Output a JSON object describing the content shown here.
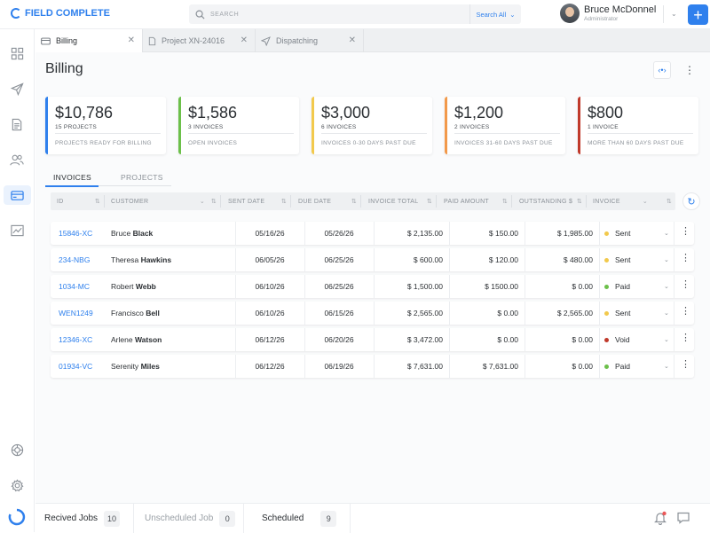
{
  "app": {
    "brand": "FIELD COMPLETE",
    "accent": "#2f80ed"
  },
  "search": {
    "placeholder": "SEARCH",
    "scope": "Search All"
  },
  "user": {
    "name": "Bruce McDonnel",
    "role": "Administrator"
  },
  "sidebar": {
    "items": [
      {
        "icon": "grid-icon"
      },
      {
        "icon": "send-icon"
      },
      {
        "icon": "document-icon"
      },
      {
        "icon": "users-icon"
      },
      {
        "icon": "credit-card-icon",
        "active": true
      },
      {
        "icon": "trending-icon"
      },
      {
        "icon": "settings-wheel-icon"
      },
      {
        "icon": "gear-icon"
      }
    ]
  },
  "tabs": [
    {
      "label": "Billing",
      "active": true
    },
    {
      "label": "Project XN-24016"
    },
    {
      "label": "Dispatching"
    }
  ],
  "page": {
    "title": "Billing"
  },
  "cards": [
    {
      "amount": "$10,786",
      "count": "15 PROJECTS",
      "desc": "PROJECTS READY FOR BILLING",
      "color": "#2f80ed"
    },
    {
      "amount": "$1,586",
      "count": "3 INVOICES",
      "desc": "OPEN INVOICES",
      "color": "#6cc04a"
    },
    {
      "amount": "$3,000",
      "count": "6 INVOICES",
      "desc": "INVOICES 0-30 DAYS PAST DUE",
      "color": "#f2c94c"
    },
    {
      "amount": "$1,200",
      "count": "2 INVOICES",
      "desc": "INVOICES 31-60 DAYS PAST DUE",
      "color": "#f2994a"
    },
    {
      "amount": "$800",
      "count": "1 INVOICE",
      "desc": "MORE THAN 60 DAYS PAST DUE",
      "color": "#c0392b"
    }
  ],
  "section_tabs": [
    "INVOICES",
    "PROJECTS"
  ],
  "table": {
    "columns": [
      "ID",
      "CUSTOMER",
      "SENT DATE",
      "DUE DATE",
      "INVOICE TOTAL",
      "PAID AMOUNT",
      "OUTSTANDING $",
      "INVOICE"
    ],
    "rows": [
      {
        "id": "15846-XC",
        "first": "Bruce",
        "last": "Black",
        "sent": "05/16/26",
        "due": "05/26/26",
        "total": "$ 2,135.00",
        "paid": "$ 150.00",
        "outstanding": "$ 1,985.00",
        "status": "Sent",
        "status_color": "#f2c94c"
      },
      {
        "id": "234-NBG",
        "first": "Theresa",
        "last": "Hawkins",
        "sent": "06/05/26",
        "due": "06/25/26",
        "total": "$ 600.00",
        "paid": "$ 120.00",
        "outstanding": "$ 480.00",
        "status": "Sent",
        "status_color": "#f2c94c"
      },
      {
        "id": "1034-MC",
        "first": "Robert",
        "last": "Webb",
        "sent": "06/10/26",
        "due": "06/25/26",
        "total": "$ 1,500.00",
        "paid": "$ 1500.00",
        "outstanding": "$ 0.00",
        "status": "Paid",
        "status_color": "#6cc04a"
      },
      {
        "id": "WEN1249",
        "first": "Francisco",
        "last": "Bell",
        "sent": "06/10/26",
        "due": "06/15/26",
        "total": "$ 2,565.00",
        "paid": "$ 0.00",
        "outstanding": "$ 2,565.00",
        "status": "Sent",
        "status_color": "#f2c94c"
      },
      {
        "id": "12346-XC",
        "first": "Arlene",
        "last": "Watson",
        "sent": "06/12/26",
        "due": "06/20/26",
        "total": "$ 3,472.00",
        "paid": "$ 0.00",
        "outstanding": "$ 0.00",
        "status": "Void",
        "status_color": "#c0392b"
      },
      {
        "id": "01934-VC",
        "first": "Serenity",
        "last": "Miles",
        "sent": "06/12/26",
        "due": "06/19/26",
        "total": "$ 7,631.00",
        "paid": "$ 7,631.00",
        "outstanding": "$ 0.00",
        "status": "Paid",
        "status_color": "#6cc04a"
      }
    ]
  },
  "footer": [
    {
      "label": "Recived Jobs",
      "count": "10"
    },
    {
      "label": "Unscheduled Job",
      "count": "0"
    },
    {
      "label": "Scheduled",
      "count": "9"
    }
  ]
}
